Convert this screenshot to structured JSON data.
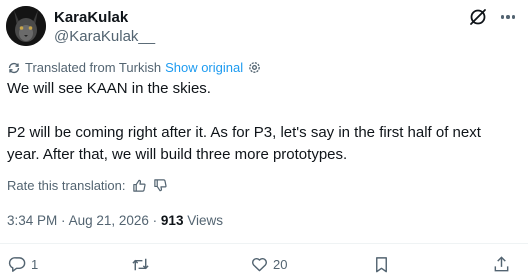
{
  "author": {
    "display_name": "KaraKulak",
    "handle": "@KaraKulak__"
  },
  "translation": {
    "label": "Translated from Turkish",
    "show_original": "Show original"
  },
  "tweet": {
    "line1": "We will see KAAN in the skies.",
    "line2": "P2 will be coming right after it. As for P3, let's say in the first half of next",
    "line3": "year. After that, we will build three more prototypes."
  },
  "rating": {
    "label": "Rate this translation:"
  },
  "meta": {
    "time": "3:34 PM",
    "date": "Aug 21, 2026",
    "separator": "·",
    "views_count": "913",
    "views_label": "Views"
  },
  "actions": {
    "replies": "1",
    "reposts": "",
    "likes": "20"
  },
  "colors": {
    "link": "#1d9bf0",
    "secondary": "#536471",
    "primary": "#0f1419"
  }
}
